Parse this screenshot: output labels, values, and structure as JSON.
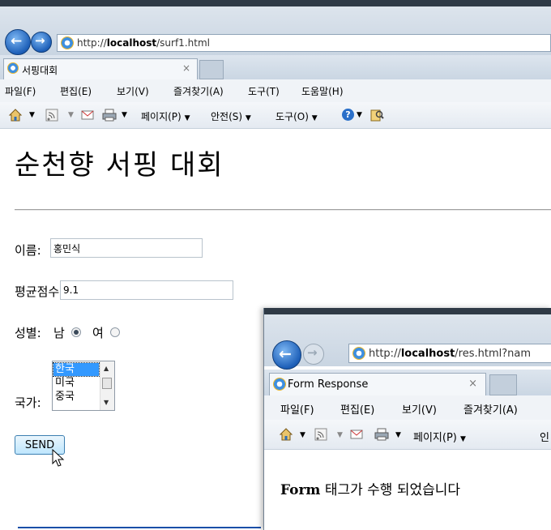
{
  "main_window": {
    "address": {
      "prefix": "http://",
      "host": "localhost",
      "path": "/surf1.html"
    },
    "tab_title": "서핑대회",
    "tab_close": "×",
    "menu": [
      "파일(F)",
      "편집(E)",
      "보기(V)",
      "즐겨찾기(A)",
      "도구(T)",
      "도움말(H)"
    ],
    "commands": {
      "page": "페이지(P)",
      "safety": "안전(S)",
      "tools": "도구(O)"
    },
    "icons": [
      "home-icon",
      "feeds-icon",
      "mail-icon",
      "print-icon",
      "help-icon",
      "research-icon"
    ]
  },
  "page": {
    "title": "순천향 서핑 대회",
    "form": {
      "name_label": "이름:",
      "name_value": "홍민식",
      "score_label": "평균점수:",
      "score_value": "9.1",
      "gender_label": "성별:",
      "gender_options": [
        {
          "label": "남",
          "checked": true
        },
        {
          "label": "여",
          "checked": false
        }
      ],
      "country_label": "국가:",
      "country_options": [
        "한국",
        "미국",
        "중국"
      ],
      "country_selected": "한국",
      "submit_label": "SEND"
    }
  },
  "response_window": {
    "address": {
      "prefix": "http://",
      "host": "localhost",
      "path": "/res.html?nam"
    },
    "tab_title": "Form Response",
    "tab_close": "×",
    "menu": [
      "파일(F)",
      "편집(E)",
      "보기(V)",
      "즐겨찾기(A)"
    ],
    "commands": {
      "page": "페이지(P)",
      "truncated": "인"
    },
    "message_bold": "Form",
    "message_rest": " 태그가 수행 되었습니다"
  },
  "colors": {
    "link_blue": "#1a4fa8",
    "selection": "#3399ff",
    "button_border": "#3c7fb1"
  }
}
